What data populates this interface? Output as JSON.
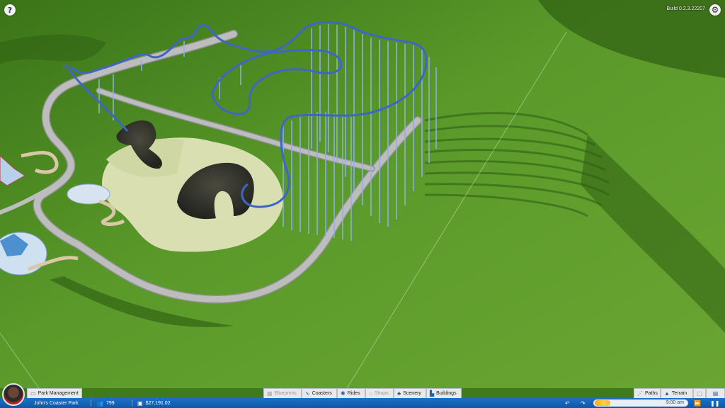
{
  "build": "Build 0.2.3.22207",
  "icons": {
    "help": "?",
    "settings": "⚙"
  },
  "tabs": {
    "park_management": "Park Management",
    "blueprints": "Blueprints",
    "coasters": "Coasters",
    "rides": "Rides",
    "shops": "Shops",
    "scenery": "Scenery",
    "buildings": "Buildings",
    "paths": "Paths",
    "terrain": "Terrain"
  },
  "status": {
    "park_name": "John's Coaster Park",
    "guests": "799",
    "money": "$27,191.02",
    "time": "9:00 am"
  },
  "colors": {
    "grass": "#4b8a22",
    "track": "#4a72c9",
    "path": "#b9b9b9",
    "ui_blue": "#1565c0"
  }
}
